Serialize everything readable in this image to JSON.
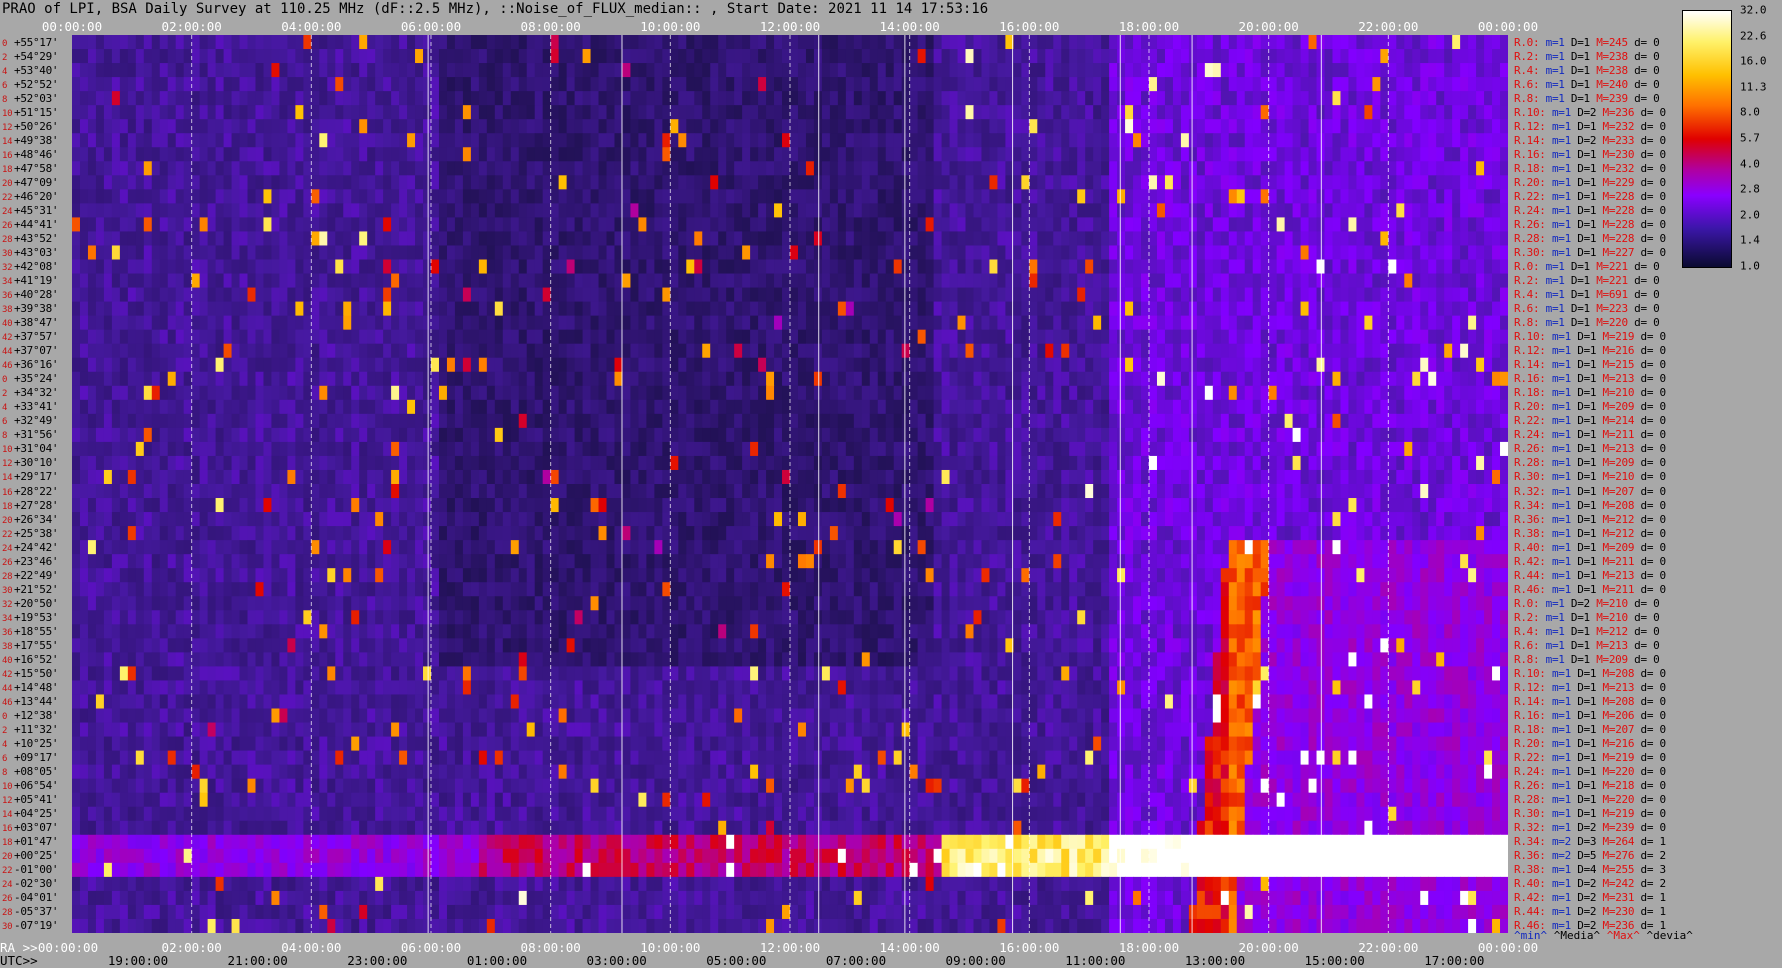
{
  "header": {
    "title": "PRAO of LPI, BSA Daily Survey at 110.25 MHz (dF::2.5 MHz), ::Noise_of_FLUX_median:: , Start Date: 2021 11 14 17:53:16"
  },
  "chart_data": {
    "type": "heatmap",
    "title": "PRAO of LPI, BSA Daily Survey at 110.25 MHz (dF::2.5 MHz), ::Noise_of_FLUX_median:: , Start Date: 2021 11 14 17:53:16",
    "x_top_ticks": [
      "00:00:00",
      "02:00:00",
      "04:00:00",
      "06:00:00",
      "08:00:00",
      "10:00:00",
      "12:00:00",
      "14:00:00",
      "16:00:00",
      "18:00:00",
      "20:00:00",
      "22:00:00",
      "00:00:00"
    ],
    "ra_prefix": "RA >>",
    "ra_ticks": [
      "00:00:00",
      "02:00:00",
      "04:00:00",
      "06:00:00",
      "08:00:00",
      "10:00:00",
      "12:00:00",
      "14:00:00",
      "16:00:00",
      "18:00:00",
      "20:00:00",
      "22:00:00",
      "00:00:00"
    ],
    "utc_prefix": "UTC>>",
    "utc_ticks": [
      "19:00:00",
      "21:00:00",
      "23:00:00",
      "01:00:00",
      "03:00:00",
      "05:00:00",
      "07:00:00",
      "09:00:00",
      "11:00:00",
      "13:00:00",
      "15:00:00",
      "17:00:00"
    ],
    "colorbar_ticks": [
      "32.0",
      "22.6",
      "16.0",
      "11.3",
      "8.0",
      "5.7",
      "4.0",
      "2.8",
      "2.0",
      "1.4",
      "1.0"
    ],
    "legend": [
      "^min^",
      "^Media^",
      "^Max^",
      "^devia^"
    ],
    "declinations": [
      "+55°17'",
      "+54°29'",
      "+53°40'",
      "+52°52'",
      "+52°03'",
      "+51°15'",
      "+50°26'",
      "+49°38'",
      "+48°46'",
      "+47°58'",
      "+47°09'",
      "+46°20'",
      "+45°31'",
      "+44°41'",
      "+43°52'",
      "+43°03'",
      "+42°08'",
      "+41°19'",
      "+40°28'",
      "+39°38'",
      "+38°47'",
      "+37°57'",
      "+37°07'",
      "+36°16'",
      "+35°24'",
      "+34°32'",
      "+33°41'",
      "+32°49'",
      "+31°56'",
      "+31°04'",
      "+30°10'",
      "+29°17'",
      "+28°22'",
      "+27°28'",
      "+26°34'",
      "+25°38'",
      "+24°42'",
      "+23°46'",
      "+22°49'",
      "+21°52'",
      "+20°50'",
      "+19°53'",
      "+18°55'",
      "+17°55'",
      "+16°52'",
      "+15°50'",
      "+14°48'",
      "+13°44'",
      "+12°38'",
      "+11°32'",
      "+10°25'",
      "+09°17'",
      "+08°05'",
      "+06°54'",
      "+05°41'",
      "+04°25'",
      "+03°07'",
      "+01°47'",
      "+00°25'",
      "-01°00'",
      "-02°30'",
      "-04°01'",
      "-05°37'",
      "-07°19'"
    ],
    "row_numbers": [
      "0",
      "2",
      "4",
      "6",
      "8",
      "10",
      "12",
      "14",
      "16",
      "18",
      "20",
      "22",
      "24",
      "26",
      "28",
      "30",
      "32",
      "34",
      "36",
      "38",
      "40",
      "42",
      "44",
      "46",
      "0",
      "2",
      "4",
      "6",
      "8",
      "10",
      "12",
      "14",
      "16",
      "18",
      "20",
      "22",
      "24",
      "26",
      "28",
      "30",
      "32",
      "34",
      "36",
      "38",
      "40",
      "42",
      "44",
      "46",
      "0",
      "2",
      "4",
      "6",
      "8",
      "10",
      "12",
      "14",
      "16",
      "18",
      "20",
      "22",
      "24",
      "26",
      "28",
      "30"
    ],
    "stats": [
      [
        "R.0:",
        "1",
        "1",
        "245",
        "0"
      ],
      [
        "R.2:",
        "1",
        "1",
        "238",
        "0"
      ],
      [
        "R.4:",
        "1",
        "1",
        "238",
        "0"
      ],
      [
        "R.6:",
        "1",
        "1",
        "240",
        "0"
      ],
      [
        "R.8:",
        "1",
        "1",
        "239",
        "0"
      ],
      [
        "R.10:",
        "1",
        "2",
        "236",
        "0"
      ],
      [
        "R.12:",
        "1",
        "1",
        "232",
        "0"
      ],
      [
        "R.14:",
        "1",
        "2",
        "233",
        "0"
      ],
      [
        "R.16:",
        "1",
        "1",
        "230",
        "0"
      ],
      [
        "R.18:",
        "1",
        "1",
        "232",
        "0"
      ],
      [
        "R.20:",
        "1",
        "1",
        "229",
        "0"
      ],
      [
        "R.22:",
        "1",
        "1",
        "228",
        "0"
      ],
      [
        "R.24:",
        "1",
        "1",
        "228",
        "0"
      ],
      [
        "R.26:",
        "1",
        "1",
        "228",
        "0"
      ],
      [
        "R.28:",
        "1",
        "1",
        "228",
        "0"
      ],
      [
        "R.30:",
        "1",
        "1",
        "227",
        "0"
      ],
      [
        "R.0:",
        "1",
        "1",
        "221",
        "0"
      ],
      [
        "R.2:",
        "1",
        "1",
        "221",
        "0"
      ],
      [
        "R.4:",
        "1",
        "1",
        "691",
        "0"
      ],
      [
        "R.6:",
        "1",
        "1",
        "223",
        "0"
      ],
      [
        "R.8:",
        "1",
        "1",
        "220",
        "0"
      ],
      [
        "R.10:",
        "1",
        "1",
        "219",
        "0"
      ],
      [
        "R.12:",
        "1",
        "1",
        "216",
        "0"
      ],
      [
        "R.14:",
        "1",
        "1",
        "215",
        "0"
      ],
      [
        "R.16:",
        "1",
        "1",
        "213",
        "0"
      ],
      [
        "R.18:",
        "1",
        "1",
        "210",
        "0"
      ],
      [
        "R.20:",
        "1",
        "1",
        "209",
        "0"
      ],
      [
        "R.22:",
        "1",
        "1",
        "214",
        "0"
      ],
      [
        "R.24:",
        "1",
        "1",
        "211",
        "0"
      ],
      [
        "R.26:",
        "1",
        "1",
        "213",
        "0"
      ],
      [
        "R.28:",
        "1",
        "1",
        "209",
        "0"
      ],
      [
        "R.30:",
        "1",
        "1",
        "210",
        "0"
      ],
      [
        "R.32:",
        "1",
        "1",
        "207",
        "0"
      ],
      [
        "R.34:",
        "1",
        "1",
        "208",
        "0"
      ],
      [
        "R.36:",
        "1",
        "1",
        "212",
        "0"
      ],
      [
        "R.38:",
        "1",
        "1",
        "212",
        "0"
      ],
      [
        "R.40:",
        "1",
        "1",
        "209",
        "0"
      ],
      [
        "R.42:",
        "1",
        "1",
        "211",
        "0"
      ],
      [
        "R.44:",
        "1",
        "1",
        "213",
        "0"
      ],
      [
        "R.46:",
        "1",
        "1",
        "211",
        "0"
      ],
      [
        "R.0:",
        "1",
        "2",
        "210",
        "0"
      ],
      [
        "R.2:",
        "1",
        "1",
        "210",
        "0"
      ],
      [
        "R.4:",
        "1",
        "1",
        "212",
        "0"
      ],
      [
        "R.6:",
        "1",
        "1",
        "213",
        "0"
      ],
      [
        "R.8:",
        "1",
        "1",
        "209",
        "0"
      ],
      [
        "R.10:",
        "1",
        "1",
        "208",
        "0"
      ],
      [
        "R.12:",
        "1",
        "1",
        "213",
        "0"
      ],
      [
        "R.14:",
        "1",
        "1",
        "208",
        "0"
      ],
      [
        "R.16:",
        "1",
        "1",
        "206",
        "0"
      ],
      [
        "R.18:",
        "1",
        "1",
        "207",
        "0"
      ],
      [
        "R.20:",
        "1",
        "1",
        "216",
        "0"
      ],
      [
        "R.22:",
        "1",
        "1",
        "219",
        "0"
      ],
      [
        "R.24:",
        "1",
        "1",
        "220",
        "0"
      ],
      [
        "R.26:",
        "1",
        "1",
        "218",
        "0"
      ],
      [
        "R.28:",
        "1",
        "1",
        "220",
        "0"
      ],
      [
        "R.30:",
        "1",
        "1",
        "219",
        "0"
      ],
      [
        "R.32:",
        "1",
        "2",
        "239",
        "0"
      ],
      [
        "R.34:",
        "2",
        "3",
        "264",
        "1"
      ],
      [
        "R.36:",
        "2",
        "5",
        "276",
        "2"
      ],
      [
        "R.38:",
        "1",
        "4",
        "255",
        "3"
      ],
      [
        "R.40:",
        "1",
        "2",
        "242",
        "2"
      ],
      [
        "R.42:",
        "1",
        "2",
        "231",
        "1"
      ],
      [
        "R.44:",
        "1",
        "2",
        "230",
        "1"
      ],
      [
        "R.46:",
        "1",
        "2",
        "236",
        "1"
      ]
    ]
  }
}
